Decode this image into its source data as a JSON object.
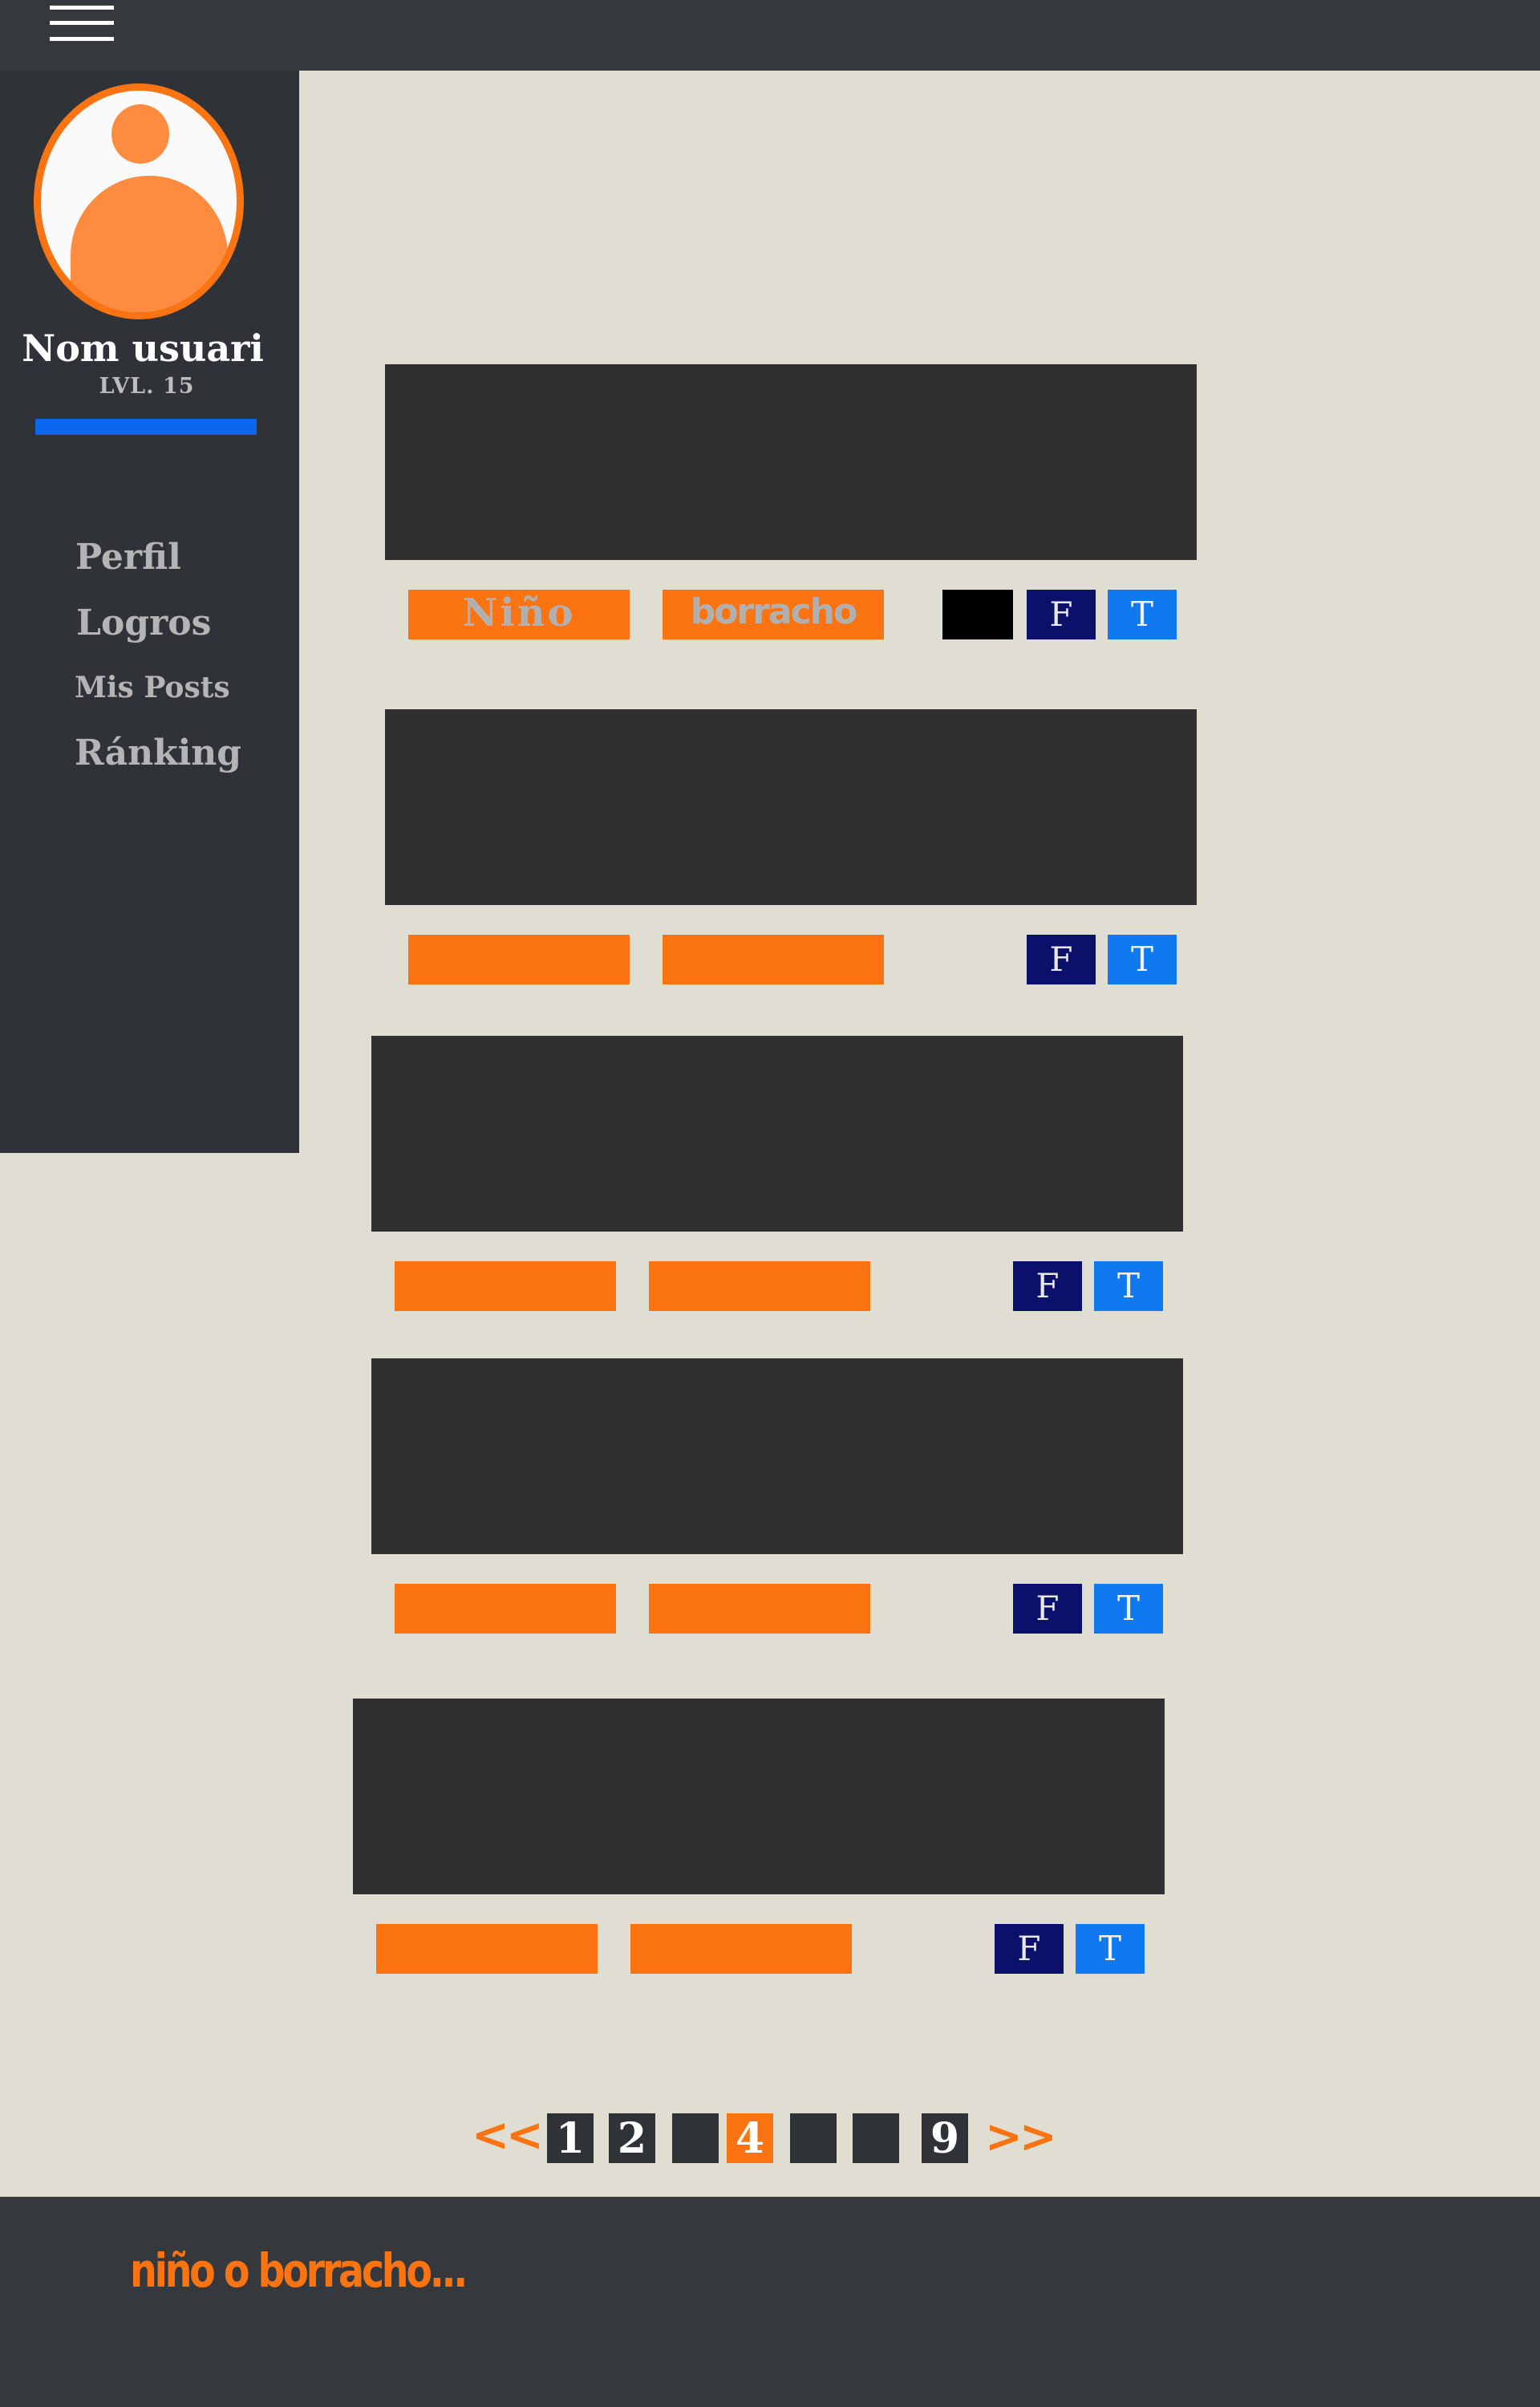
{
  "header": {
    "menu_icon": "hamburger-menu-icon"
  },
  "sidebar": {
    "avatar_icon": "user-avatar-icon",
    "user_name": "Nom usuari",
    "level": "LVL. 15",
    "xp_progress": 1.0,
    "nav": [
      {
        "label": "Perfil"
      },
      {
        "label": "Logros"
      },
      {
        "label": "Mis Posts"
      },
      {
        "label": "Ránking"
      }
    ]
  },
  "posts": [
    {
      "tag1": "Niño",
      "tag2": "borracho",
      "share_facebook": "F",
      "share_twitter": "T"
    },
    {
      "tag1": "",
      "tag2": "",
      "share_facebook": "F",
      "share_twitter": "T"
    },
    {
      "tag1": "",
      "tag2": "",
      "share_facebook": "F",
      "share_twitter": "T"
    },
    {
      "tag1": "",
      "tag2": "",
      "share_facebook": "F",
      "share_twitter": "T"
    },
    {
      "tag1": "",
      "tag2": "",
      "share_facebook": "F",
      "share_twitter": "T"
    }
  ],
  "pagination": {
    "prev": "<<",
    "next": ">>",
    "pages": [
      "1",
      "2",
      "",
      "4",
      "",
      "",
      "9"
    ],
    "current": "4"
  },
  "footer": {
    "brand": "niño o borracho..."
  },
  "colors": {
    "accent": "#fc7412",
    "dark": "#2f3337",
    "background": "#e0ddd3",
    "facebook": "#0b116b",
    "twitter": "#1179f0",
    "xp_bar": "#0a66ec"
  }
}
